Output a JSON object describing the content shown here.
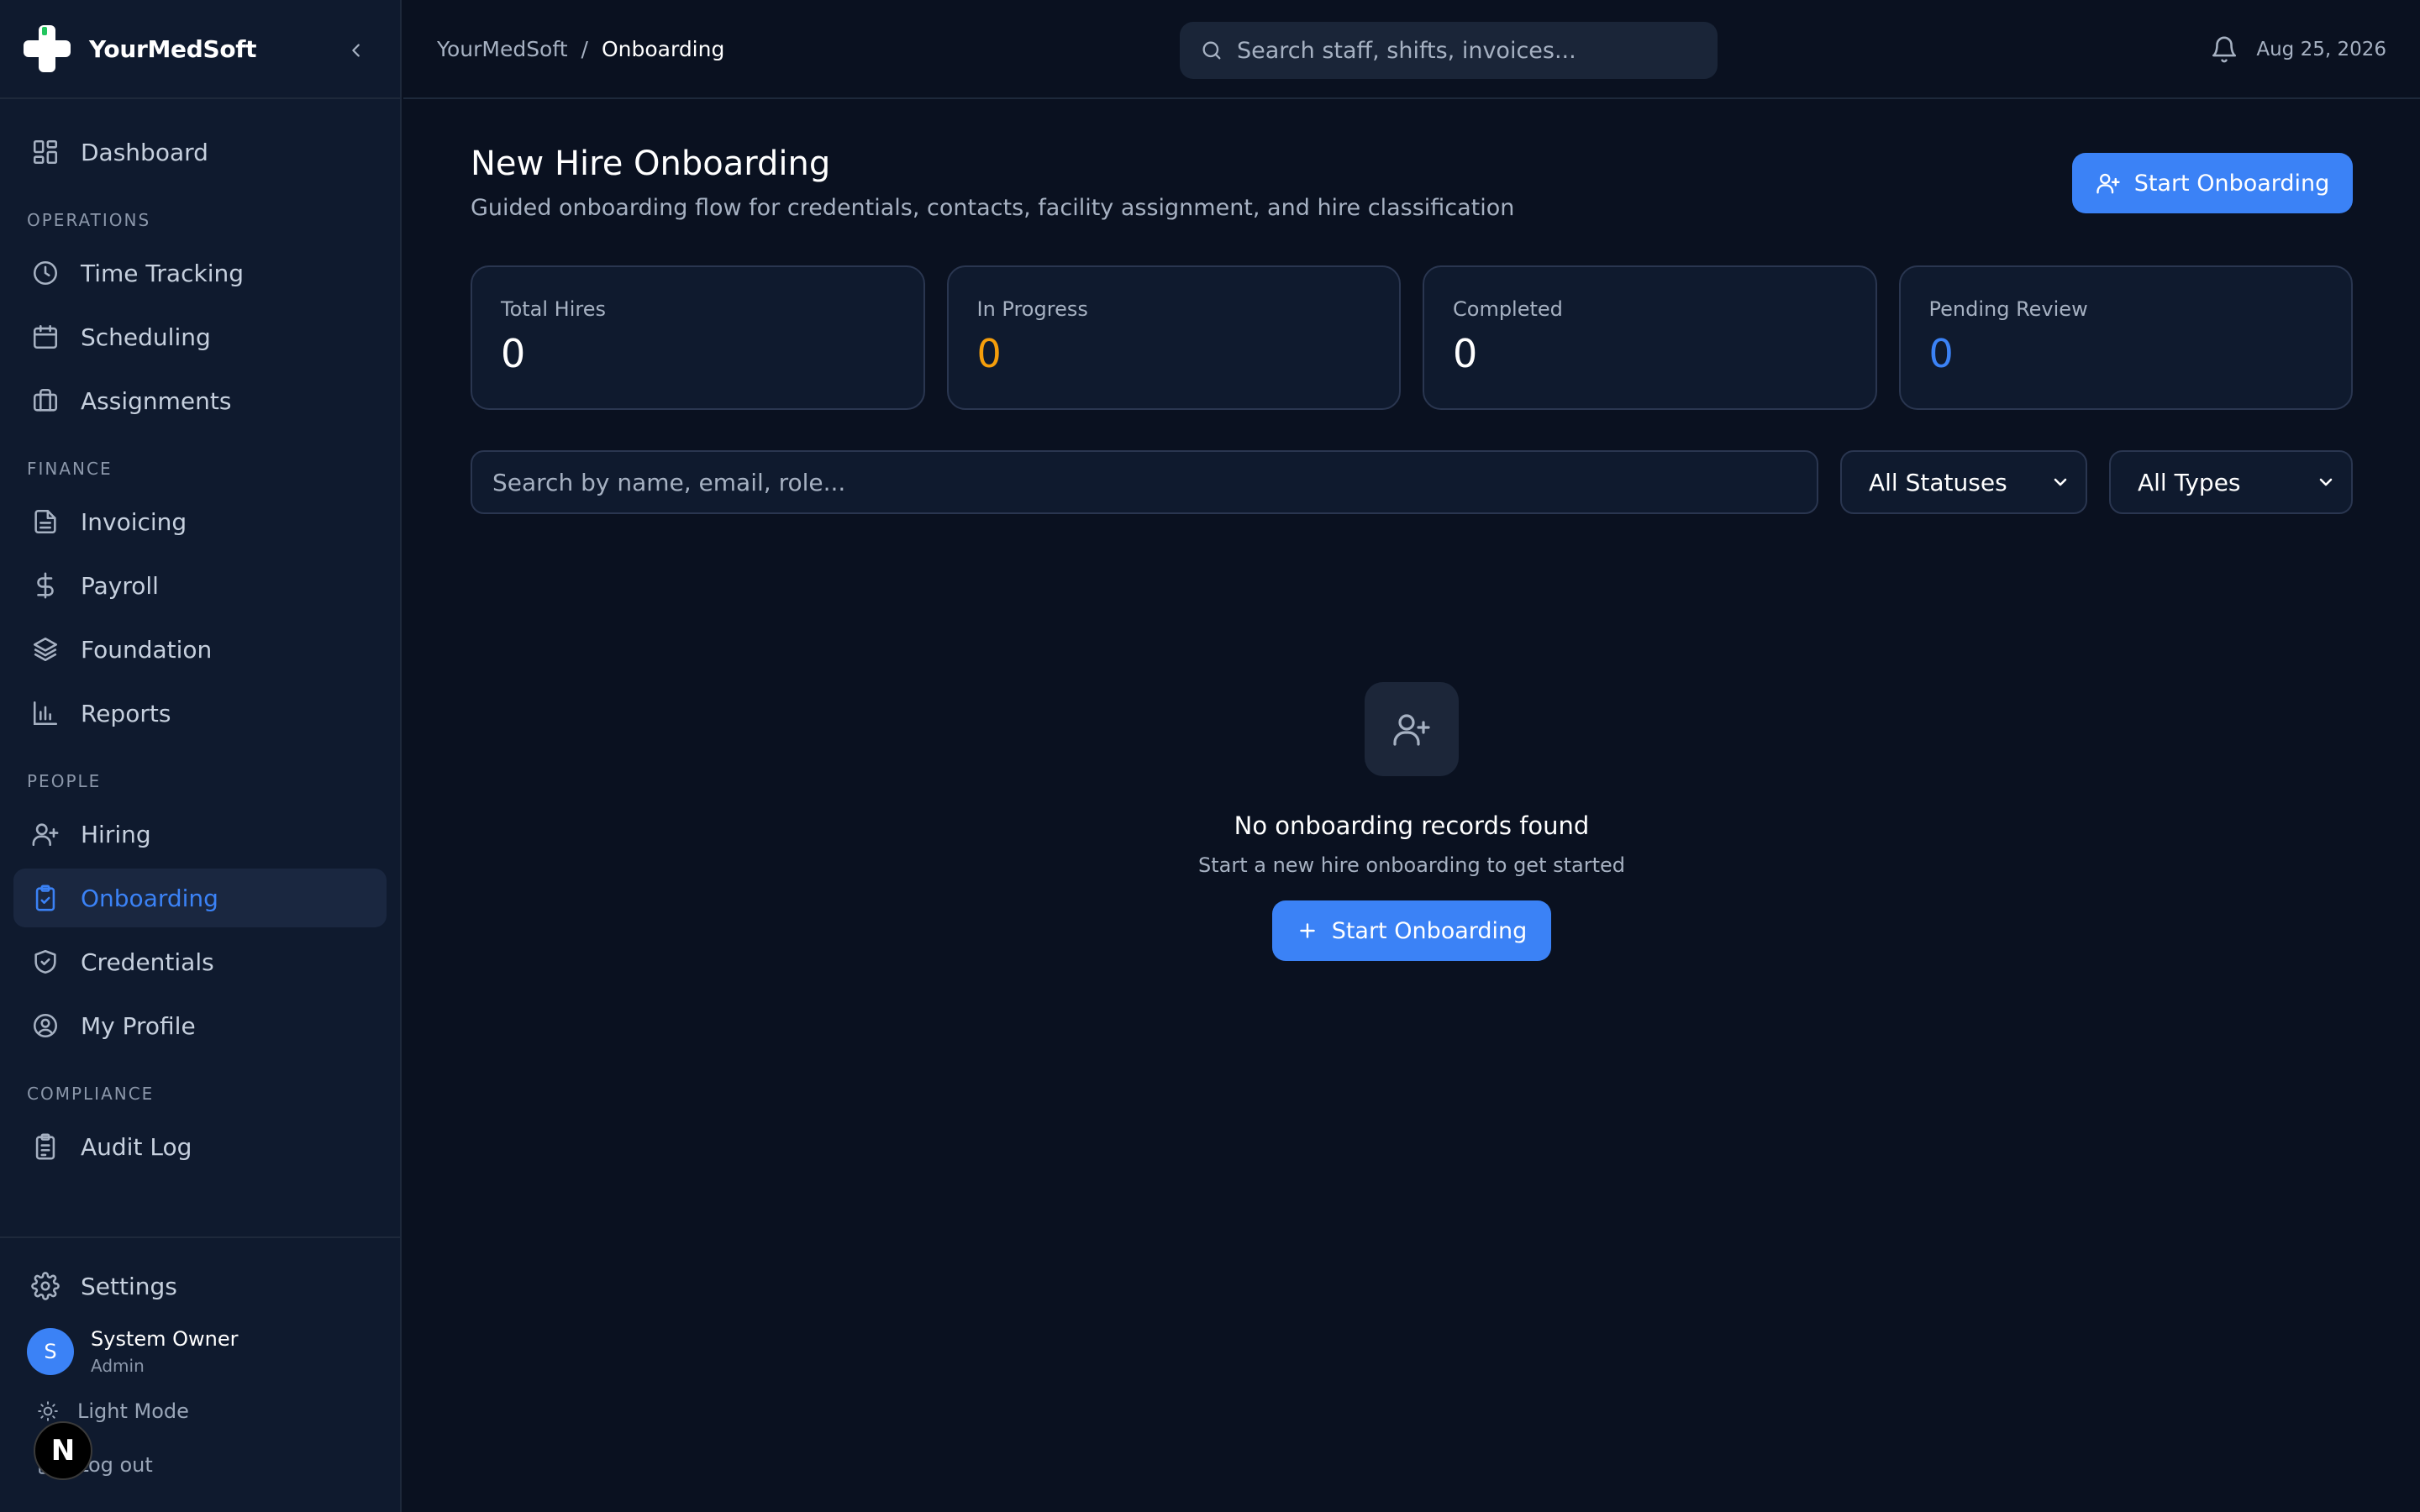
{
  "brand": {
    "name": "YourMedSoft"
  },
  "sidebar": {
    "dashboard": {
      "label": "Dashboard",
      "icon": "dashboard-icon"
    },
    "sections": [
      {
        "title": "OPERATIONS",
        "items": [
          {
            "label": "Time Tracking",
            "icon": "clock-icon"
          },
          {
            "label": "Scheduling",
            "icon": "calendar-icon"
          },
          {
            "label": "Assignments",
            "icon": "briefcase-icon"
          }
        ]
      },
      {
        "title": "FINANCE",
        "items": [
          {
            "label": "Invoicing",
            "icon": "file-text-icon"
          },
          {
            "label": "Payroll",
            "icon": "dollar-icon"
          },
          {
            "label": "Foundation",
            "icon": "layers-icon"
          },
          {
            "label": "Reports",
            "icon": "bar-chart-icon"
          }
        ]
      },
      {
        "title": "PEOPLE",
        "items": [
          {
            "label": "Hiring",
            "icon": "user-plus-icon"
          },
          {
            "label": "Onboarding",
            "icon": "clipboard-check-icon",
            "active": true
          },
          {
            "label": "Credentials",
            "icon": "shield-check-icon"
          },
          {
            "label": "My Profile",
            "icon": "user-circle-icon"
          }
        ]
      },
      {
        "title": "COMPLIANCE",
        "items": [
          {
            "label": "Audit Log",
            "icon": "clipboard-list-icon"
          }
        ]
      }
    ],
    "settings": {
      "label": "Settings",
      "icon": "gear-icon"
    },
    "user": {
      "initial": "S",
      "name": "System Owner",
      "role": "Admin"
    },
    "theme_toggle": {
      "label": "Light Mode",
      "icon": "sun-icon"
    },
    "logout": {
      "label": "Log out",
      "icon": "logout-icon"
    },
    "dev_badge": "N"
  },
  "topbar": {
    "breadcrumb": {
      "root": "YourMedSoft",
      "separator": "/",
      "current": "Onboarding"
    },
    "search_placeholder": "Search staff, shifts, invoices...",
    "date": "Aug 25, 2026"
  },
  "page": {
    "title": "New Hire Onboarding",
    "subtitle": "Guided onboarding flow for credentials, contacts, facility assignment, and hire classification",
    "primary_button": "Start Onboarding"
  },
  "stats": [
    {
      "label": "Total Hires",
      "value": "0",
      "color": "#ffffff"
    },
    {
      "label": "In Progress",
      "value": "0",
      "color": "#f59e0b"
    },
    {
      "label": "Completed",
      "value": "0",
      "color": "#ffffff"
    },
    {
      "label": "Pending Review",
      "value": "0",
      "color": "#3b82f6"
    }
  ],
  "filters": {
    "search_placeholder": "Search by name, email, role...",
    "status_selected": "All Statuses",
    "type_selected": "All Types"
  },
  "empty_state": {
    "icon": "user-plus-icon",
    "title": "No onboarding records found",
    "subtitle": "Start a new hire onboarding to get started",
    "button": "Start Onboarding"
  },
  "colors": {
    "accent": "#3b82f6",
    "background": "#0a1120",
    "sidebar": "#0f1a2e",
    "warning": "#f59e0b"
  }
}
